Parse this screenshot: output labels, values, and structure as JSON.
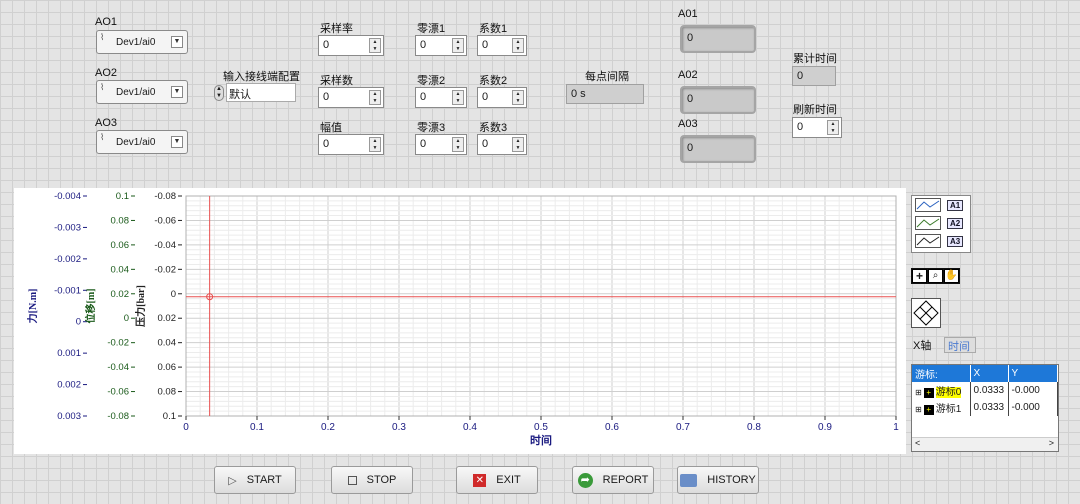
{
  "ao_selectors": [
    {
      "label": "AO1",
      "value": "Dev1/ai0"
    },
    {
      "label": "AO2",
      "value": "Dev1/ai0"
    },
    {
      "label": "AO3",
      "value": "Dev1/ai0"
    }
  ],
  "input_config": {
    "label": "输入接线端配置",
    "value": "默认"
  },
  "sampling": {
    "rate": {
      "label": "采样率",
      "value": "0"
    },
    "count": {
      "label": "采样数",
      "value": "0"
    },
    "amplitude": {
      "label": "幅值",
      "value": "0"
    }
  },
  "zero_drift": [
    {
      "label": "零漂1",
      "value": "0"
    },
    {
      "label": "零漂2",
      "value": "0"
    },
    {
      "label": "零漂3",
      "value": "0"
    }
  ],
  "coefficient": [
    {
      "label": "系数1",
      "value": "0"
    },
    {
      "label": "系数2",
      "value": "0"
    },
    {
      "label": "系数3",
      "value": "0"
    }
  ],
  "interval": {
    "label": "每点间隔",
    "value": "0 s"
  },
  "ao_outputs": [
    {
      "label": "A01",
      "value": "0"
    },
    {
      "label": "A02",
      "value": "0"
    },
    {
      "label": "A03",
      "value": "0"
    }
  ],
  "cumulative_time": {
    "label": "累计时间",
    "value": "0"
  },
  "refresh_time": {
    "label": "刷新时间",
    "value": "0"
  },
  "chart_data": {
    "type": "line",
    "xlabel": "时间",
    "xlim": [
      0,
      1
    ],
    "x_ticks": [
      "0",
      "0.1",
      "0.2",
      "0.3",
      "0.4",
      "0.5",
      "0.6",
      "0.7",
      "0.8",
      "0.9",
      "1"
    ],
    "y_axes": [
      {
        "label": "力[N.m]",
        "color": "#1a1a80",
        "ticks": [
          "-0.004",
          "-0.003",
          "-0.002",
          "-0.001",
          "0",
          "0.001",
          "0.002",
          "0.003"
        ]
      },
      {
        "label": "位移[m]",
        "color": "#1a5a1a",
        "ticks": [
          "0.1",
          "0.08",
          "0.06",
          "0.04",
          "0.02",
          "0",
          "-0.02",
          "-0.04",
          "-0.06",
          "-0.08"
        ]
      },
      {
        "label": "压力[bar]",
        "color": "#222222",
        "ticks": [
          "-0.08",
          "-0.06",
          "-0.04",
          "-0.02",
          "0",
          "0.02",
          "0.04",
          "0.06",
          "0.08",
          "0.1"
        ]
      }
    ],
    "cursor_x": 0.0333,
    "cursor_color": "#e85050",
    "series": []
  },
  "legend": [
    "A1",
    "A2",
    "A3"
  ],
  "x_axis_label": "X轴",
  "x_axis_format": "时间",
  "cursor_table": {
    "headers": [
      "游标:",
      "X",
      "Y"
    ],
    "rows": [
      {
        "name": "游标0",
        "x": "0.0333",
        "y": "-0.000"
      },
      {
        "name": "游标1",
        "x": "0.0333",
        "y": "-0.000"
      }
    ]
  },
  "buttons": {
    "start": "START",
    "stop": "STOP",
    "exit": "EXIT",
    "report": "REPORT",
    "history": "HISTORY"
  }
}
